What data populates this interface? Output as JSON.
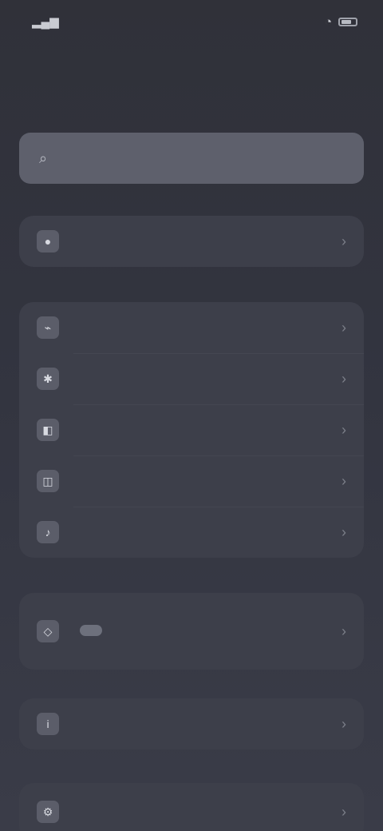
{
  "status": {
    "time": "",
    "signal": "",
    "battery": ""
  },
  "nav": {
    "caption": "",
    "title": ""
  },
  "search": {
    "placeholder": "",
    "value": ""
  },
  "account": {
    "label": "",
    "value": ""
  },
  "settings": {
    "items": [
      {
        "label": "",
        "value": ""
      },
      {
        "label": "",
        "value": ""
      },
      {
        "label": "",
        "value": ""
      },
      {
        "label": "",
        "value": ""
      },
      {
        "label": "",
        "value": ""
      }
    ]
  },
  "featured": {
    "label": "",
    "tag": "",
    "value": ""
  },
  "extra": {
    "label": "",
    "value": ""
  },
  "footer": {
    "label": "",
    "value": ""
  }
}
